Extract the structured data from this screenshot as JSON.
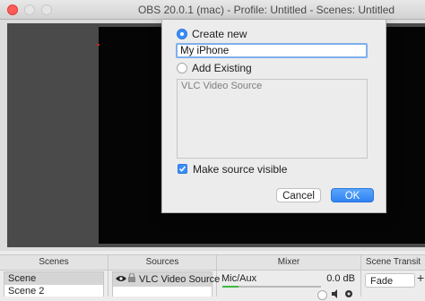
{
  "window": {
    "title": "OBS 20.0.1 (mac) - Profile: Untitled - Scenes: Untitled"
  },
  "dialog": {
    "create_new_label": "Create new",
    "name_value": "My iPhone",
    "add_existing_label": "Add Existing",
    "existing_items": [
      "VLC Video Source"
    ],
    "make_visible_label": "Make source visible",
    "cancel_label": "Cancel",
    "ok_label": "OK"
  },
  "docks": {
    "scenes": {
      "title": "Scenes",
      "items": [
        "Scene",
        "Scene 2"
      ]
    },
    "sources": {
      "title": "Sources",
      "items": [
        "VLC Video Source"
      ]
    },
    "mixer": {
      "title": "Mixer",
      "channel_name": "Mic/Aux",
      "level": "0.0 dB"
    },
    "transitions": {
      "title": "Scene Transit",
      "selected": "Fade"
    }
  },
  "colors": {
    "accent": "#3b8df7",
    "close": "#fc5b57",
    "canvas": "#050505"
  }
}
